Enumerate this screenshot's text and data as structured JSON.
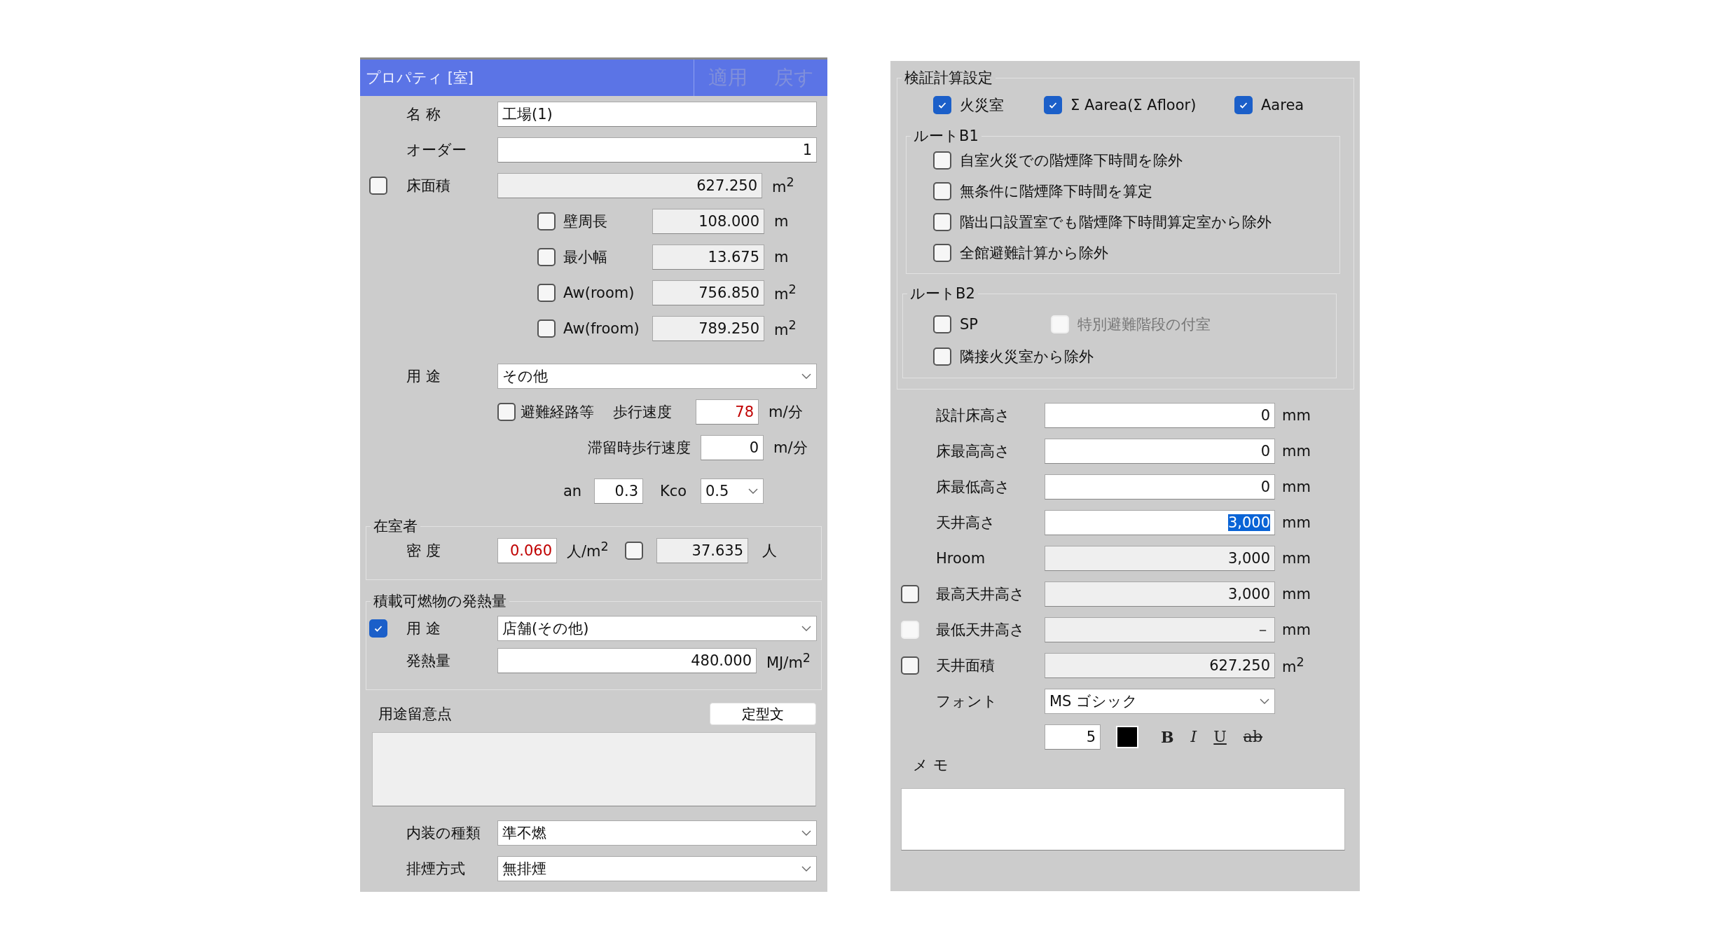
{
  "properties": {
    "title": "プロパティ [室]",
    "header_buttons": [
      {
        "label": "適用",
        "disabled": true
      },
      {
        "label": "戻す",
        "disabled": true
      }
    ],
    "name": {
      "label": "名 称",
      "value": "工場(1)"
    },
    "order": {
      "label": "オーダー",
      "value": "1"
    },
    "floor_area": {
      "label": "床面積",
      "checked": false,
      "value": "627.250",
      "unit": "m$^{2}$"
    },
    "sub_measures": [
      {
        "label": "壁周長",
        "checked": false,
        "value": "108.000",
        "unit": "m"
      },
      {
        "label": "最小幅",
        "checked": false,
        "value": "13.675",
        "unit": "m"
      },
      {
        "label": "Aw(room)",
        "checked": false,
        "value": "756.850",
        "unit": "m$^{2}$"
      },
      {
        "label": "Aw(froom)",
        "checked": false,
        "value": "789.250",
        "unit": "m$^{2}$"
      }
    ],
    "use": {
      "label": "用 途",
      "value": "その他"
    },
    "evacuation_route": {
      "label": "避難経路等",
      "checked": false
    },
    "walk_speed": {
      "label": "歩行速度",
      "value": "78",
      "warning": true,
      "unit": "m/分"
    },
    "stagnant_speed": {
      "label": "滞留時歩行速度",
      "value": "0",
      "warning": false,
      "unit": "m/分"
    },
    "an": {
      "label": "an",
      "value": "0.3"
    },
    "kco": {
      "label": "Kco",
      "value": "0.5"
    },
    "occupants": {
      "title": "在室者",
      "density_label": "密 度",
      "density": "0.060",
      "density_warning": true,
      "density_unit": "人/m$^{2}$",
      "count_checked": false,
      "count": "37.635",
      "count_unit": "人"
    },
    "fire_load": {
      "title": "積載可燃物の発熱量",
      "use_checked": true,
      "use_label": "用 途",
      "use_value": "店舗(その他)",
      "heat_label": "発熱量",
      "heat_value": "480.000",
      "heat_unit": "MJ/m$^{2}$"
    },
    "notes": {
      "label": "用途留意点",
      "button": "定型文"
    },
    "interior": {
      "label": "内装の種類",
      "value": "準不燃"
    },
    "smoke": {
      "label": "排煙方式",
      "value": "無排煙"
    }
  },
  "verification": {
    "title": "検証計算設定",
    "checks": [
      {
        "label": "火災室",
        "checked": true
      },
      {
        "label": "Σ Aarea(Σ Afloor)",
        "checked": true
      },
      {
        "label": "Aarea",
        "checked": true
      }
    ],
    "route_b1": {
      "title": "ルートB1",
      "options": [
        {
          "label": "自室火災での階煙降下時間を除外",
          "checked": false
        },
        {
          "label": "無条件に階煙降下時間を算定",
          "checked": false
        },
        {
          "label": "階出口設置室でも階煙降下時間算定室から除外",
          "checked": false
        },
        {
          "label": "全館避難計算から除外",
          "checked": false
        }
      ]
    },
    "route_b2": {
      "title": "ルートB2",
      "options": [
        {
          "label": "SP",
          "checked": false,
          "disabled": false
        },
        {
          "label": "特別避難階段の付室",
          "checked": false,
          "disabled": true
        },
        {
          "label": "隣接火災室から除外",
          "checked": false,
          "disabled": false
        }
      ]
    }
  },
  "heights": [
    {
      "kind": "field",
      "label": "設計床高さ",
      "value": "0",
      "unit": "mm",
      "readonly": false,
      "selected": false
    },
    {
      "kind": "field",
      "label": "床最高高さ",
      "value": "0",
      "unit": "mm",
      "readonly": false,
      "selected": false
    },
    {
      "kind": "field",
      "label": "床最低高さ",
      "value": "0",
      "unit": "mm",
      "readonly": false,
      "selected": false
    },
    {
      "kind": "field",
      "label": "天井高さ",
      "value": "3,000",
      "unit": "mm",
      "readonly": false,
      "selected": true
    },
    {
      "kind": "field",
      "label": "Hroom",
      "value": "3,000",
      "unit": "mm",
      "readonly": true,
      "selected": false
    },
    {
      "kind": "check_field",
      "label": "最高天井高さ",
      "checked": false,
      "disabled": false,
      "value": "3,000",
      "unit": "mm",
      "readonly": true,
      "selected": false
    },
    {
      "kind": "check_field",
      "label": "最低天井高さ",
      "checked": false,
      "disabled": true,
      "value": "－",
      "unit": "mm",
      "readonly": true,
      "selected": false
    },
    {
      "kind": "check_field",
      "label": "天井面積",
      "checked": false,
      "disabled": false,
      "value": "627.250",
      "unit": "m$^{2}$",
      "readonly": true,
      "selected": false
    }
  ],
  "font": {
    "label": "フォント",
    "value": "MS ゴシック",
    "size": "5",
    "color": "#000000",
    "styles": [
      {
        "label": "B",
        "kind": "bold"
      },
      {
        "label": "I",
        "kind": "italic"
      },
      {
        "label": "U",
        "kind": "underline"
      },
      {
        "label": "ab",
        "kind": "strike"
      }
    ]
  },
  "memo": {
    "label": "メ モ"
  }
}
